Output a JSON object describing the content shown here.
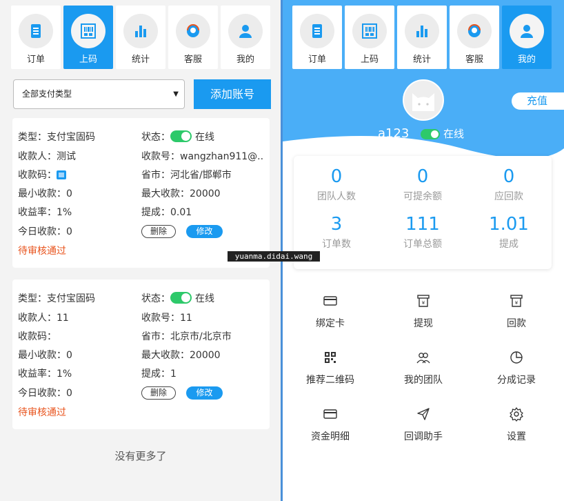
{
  "left": {
    "nav": [
      {
        "label": "订单",
        "icon": "clipboard-icon"
      },
      {
        "label": "上码",
        "icon": "barcode-icon",
        "active": true
      },
      {
        "label": "统计",
        "icon": "bar-chart-icon"
      },
      {
        "label": "客服",
        "icon": "headset-icon"
      },
      {
        "label": "我的",
        "icon": "user-icon"
      }
    ],
    "filter": {
      "selected": "全部支付类型"
    },
    "add_button": "添加账号",
    "accounts": [
      {
        "type": "类型：支付宝固码",
        "status_label": "状态：",
        "status_value": "在线",
        "payee": "收款人：测试",
        "account_no": "收款号：wangzhan911@..",
        "qrcode": "收款码：",
        "region": "省市：河北省/邯郸市",
        "min": "最小收款：0",
        "max": "最大收款：20000",
        "rate": "收益率：1%",
        "commission": "提成：0.01",
        "today": "今日收款：0",
        "delete": "删除",
        "edit": "修改",
        "review": "待审核通过"
      },
      {
        "type": "类型：支付宝固码",
        "status_label": "状态：",
        "status_value": "在线",
        "payee": "收款人：11",
        "account_no": "收款号：11",
        "qrcode": "收款码：",
        "region": "省市：北京市/北京市",
        "min": "最小收款：0",
        "max": "最大收款：20000",
        "rate": "收益率：1%",
        "commission": "提成：1",
        "today": "今日收款：0",
        "delete": "删除",
        "edit": "修改",
        "review": "待审核通过"
      }
    ],
    "no_more": "没有更多了"
  },
  "watermark": "yuanma.didai.wang",
  "right": {
    "nav": [
      {
        "label": "订单",
        "icon": "clipboard-icon"
      },
      {
        "label": "上码",
        "icon": "barcode-icon"
      },
      {
        "label": "统计",
        "icon": "bar-chart-icon"
      },
      {
        "label": "客服",
        "icon": "headset-icon"
      },
      {
        "label": "我的",
        "icon": "user-icon",
        "active": true
      }
    ],
    "recharge": "充值",
    "username": "a123",
    "status": "在线",
    "stats": [
      {
        "value": "0",
        "label": "团队人数"
      },
      {
        "value": "0",
        "label": "可提余额"
      },
      {
        "value": "0",
        "label": "应回款"
      },
      {
        "value": "3",
        "label": "订单数"
      },
      {
        "value": "111",
        "label": "订单总额"
      },
      {
        "value": "1.01",
        "label": "提成"
      }
    ],
    "menu": [
      {
        "label": "绑定卡",
        "icon": "card-icon"
      },
      {
        "label": "提现",
        "icon": "withdraw-icon"
      },
      {
        "label": "回款",
        "icon": "repayment-icon"
      },
      {
        "label": "推荐二维码",
        "icon": "qrcode-icon"
      },
      {
        "label": "我的团队",
        "icon": "team-icon"
      },
      {
        "label": "分成记录",
        "icon": "pie-chart-icon"
      },
      {
        "label": "资金明细",
        "icon": "wallet-icon"
      },
      {
        "label": "回调助手",
        "icon": "send-icon"
      },
      {
        "label": "设置",
        "icon": "settings-icon"
      }
    ]
  },
  "colors": {
    "accent": "#1a9af0",
    "online": "#2dc96a",
    "pending": "#e8541e",
    "hero": "#4aaef7"
  }
}
